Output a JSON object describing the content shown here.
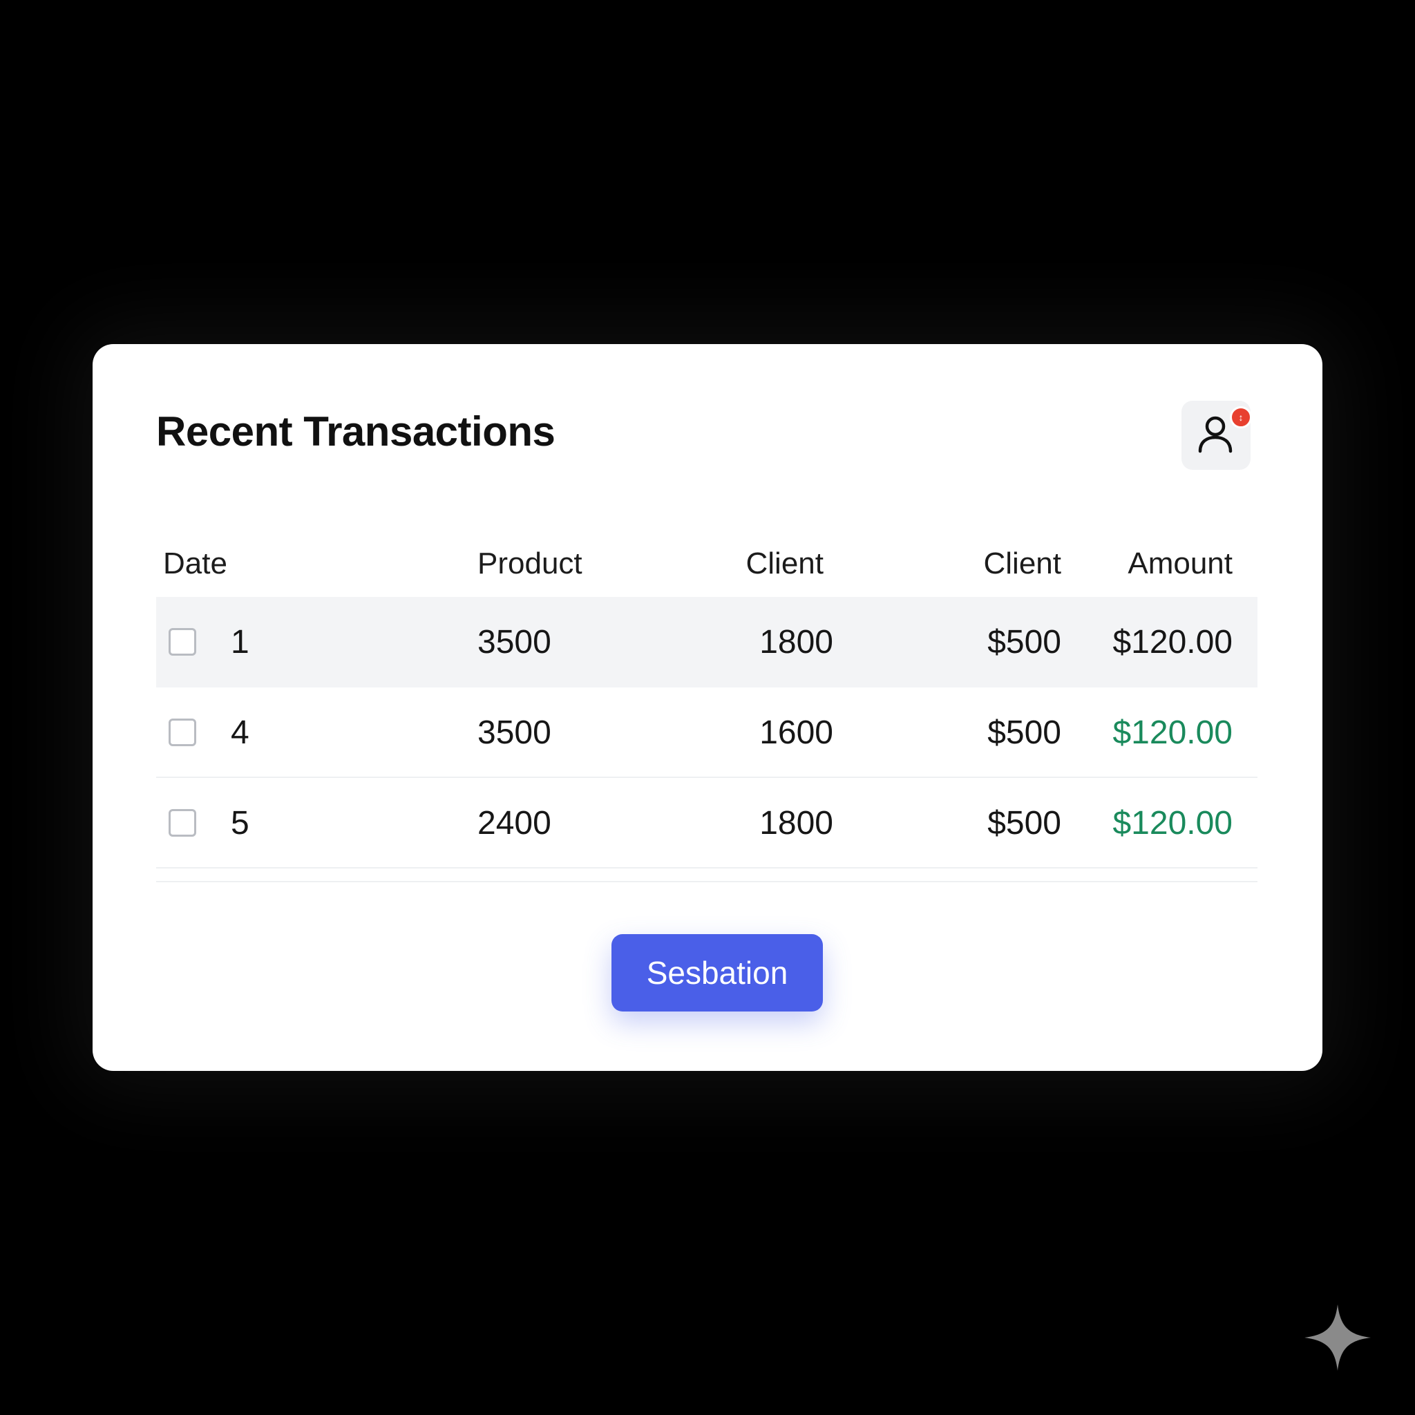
{
  "card": {
    "title": "Recent Transactions"
  },
  "profile": {
    "badge": "↕"
  },
  "table": {
    "headers": [
      "Date",
      "Product",
      "Client",
      "Client",
      "Amount"
    ],
    "rows": [
      {
        "date": "1",
        "product": "3500",
        "client1": "1800",
        "client2": "$500",
        "amount": "$120.00",
        "highlighted": true,
        "amount_color": "#161616"
      },
      {
        "date": "4",
        "product": "3500",
        "client1": "1600",
        "client2": "$500",
        "amount": "$120.00",
        "highlighted": false,
        "amount_color": "#1a8a5c"
      },
      {
        "date": "5",
        "product": "2400",
        "client1": "1800",
        "client2": "$500",
        "amount": "$120.00",
        "highlighted": false,
        "amount_color": "#1a8a5c"
      }
    ]
  },
  "actions": {
    "primary_label": "Sesbation"
  },
  "colors": {
    "accent": "#4a5fe8",
    "positive": "#1a8a5c",
    "badge": "#e8402f",
    "row_highlight": "#f3f4f6"
  },
  "icons": {
    "profile": "user-icon",
    "watermark": "sparkle-icon"
  }
}
